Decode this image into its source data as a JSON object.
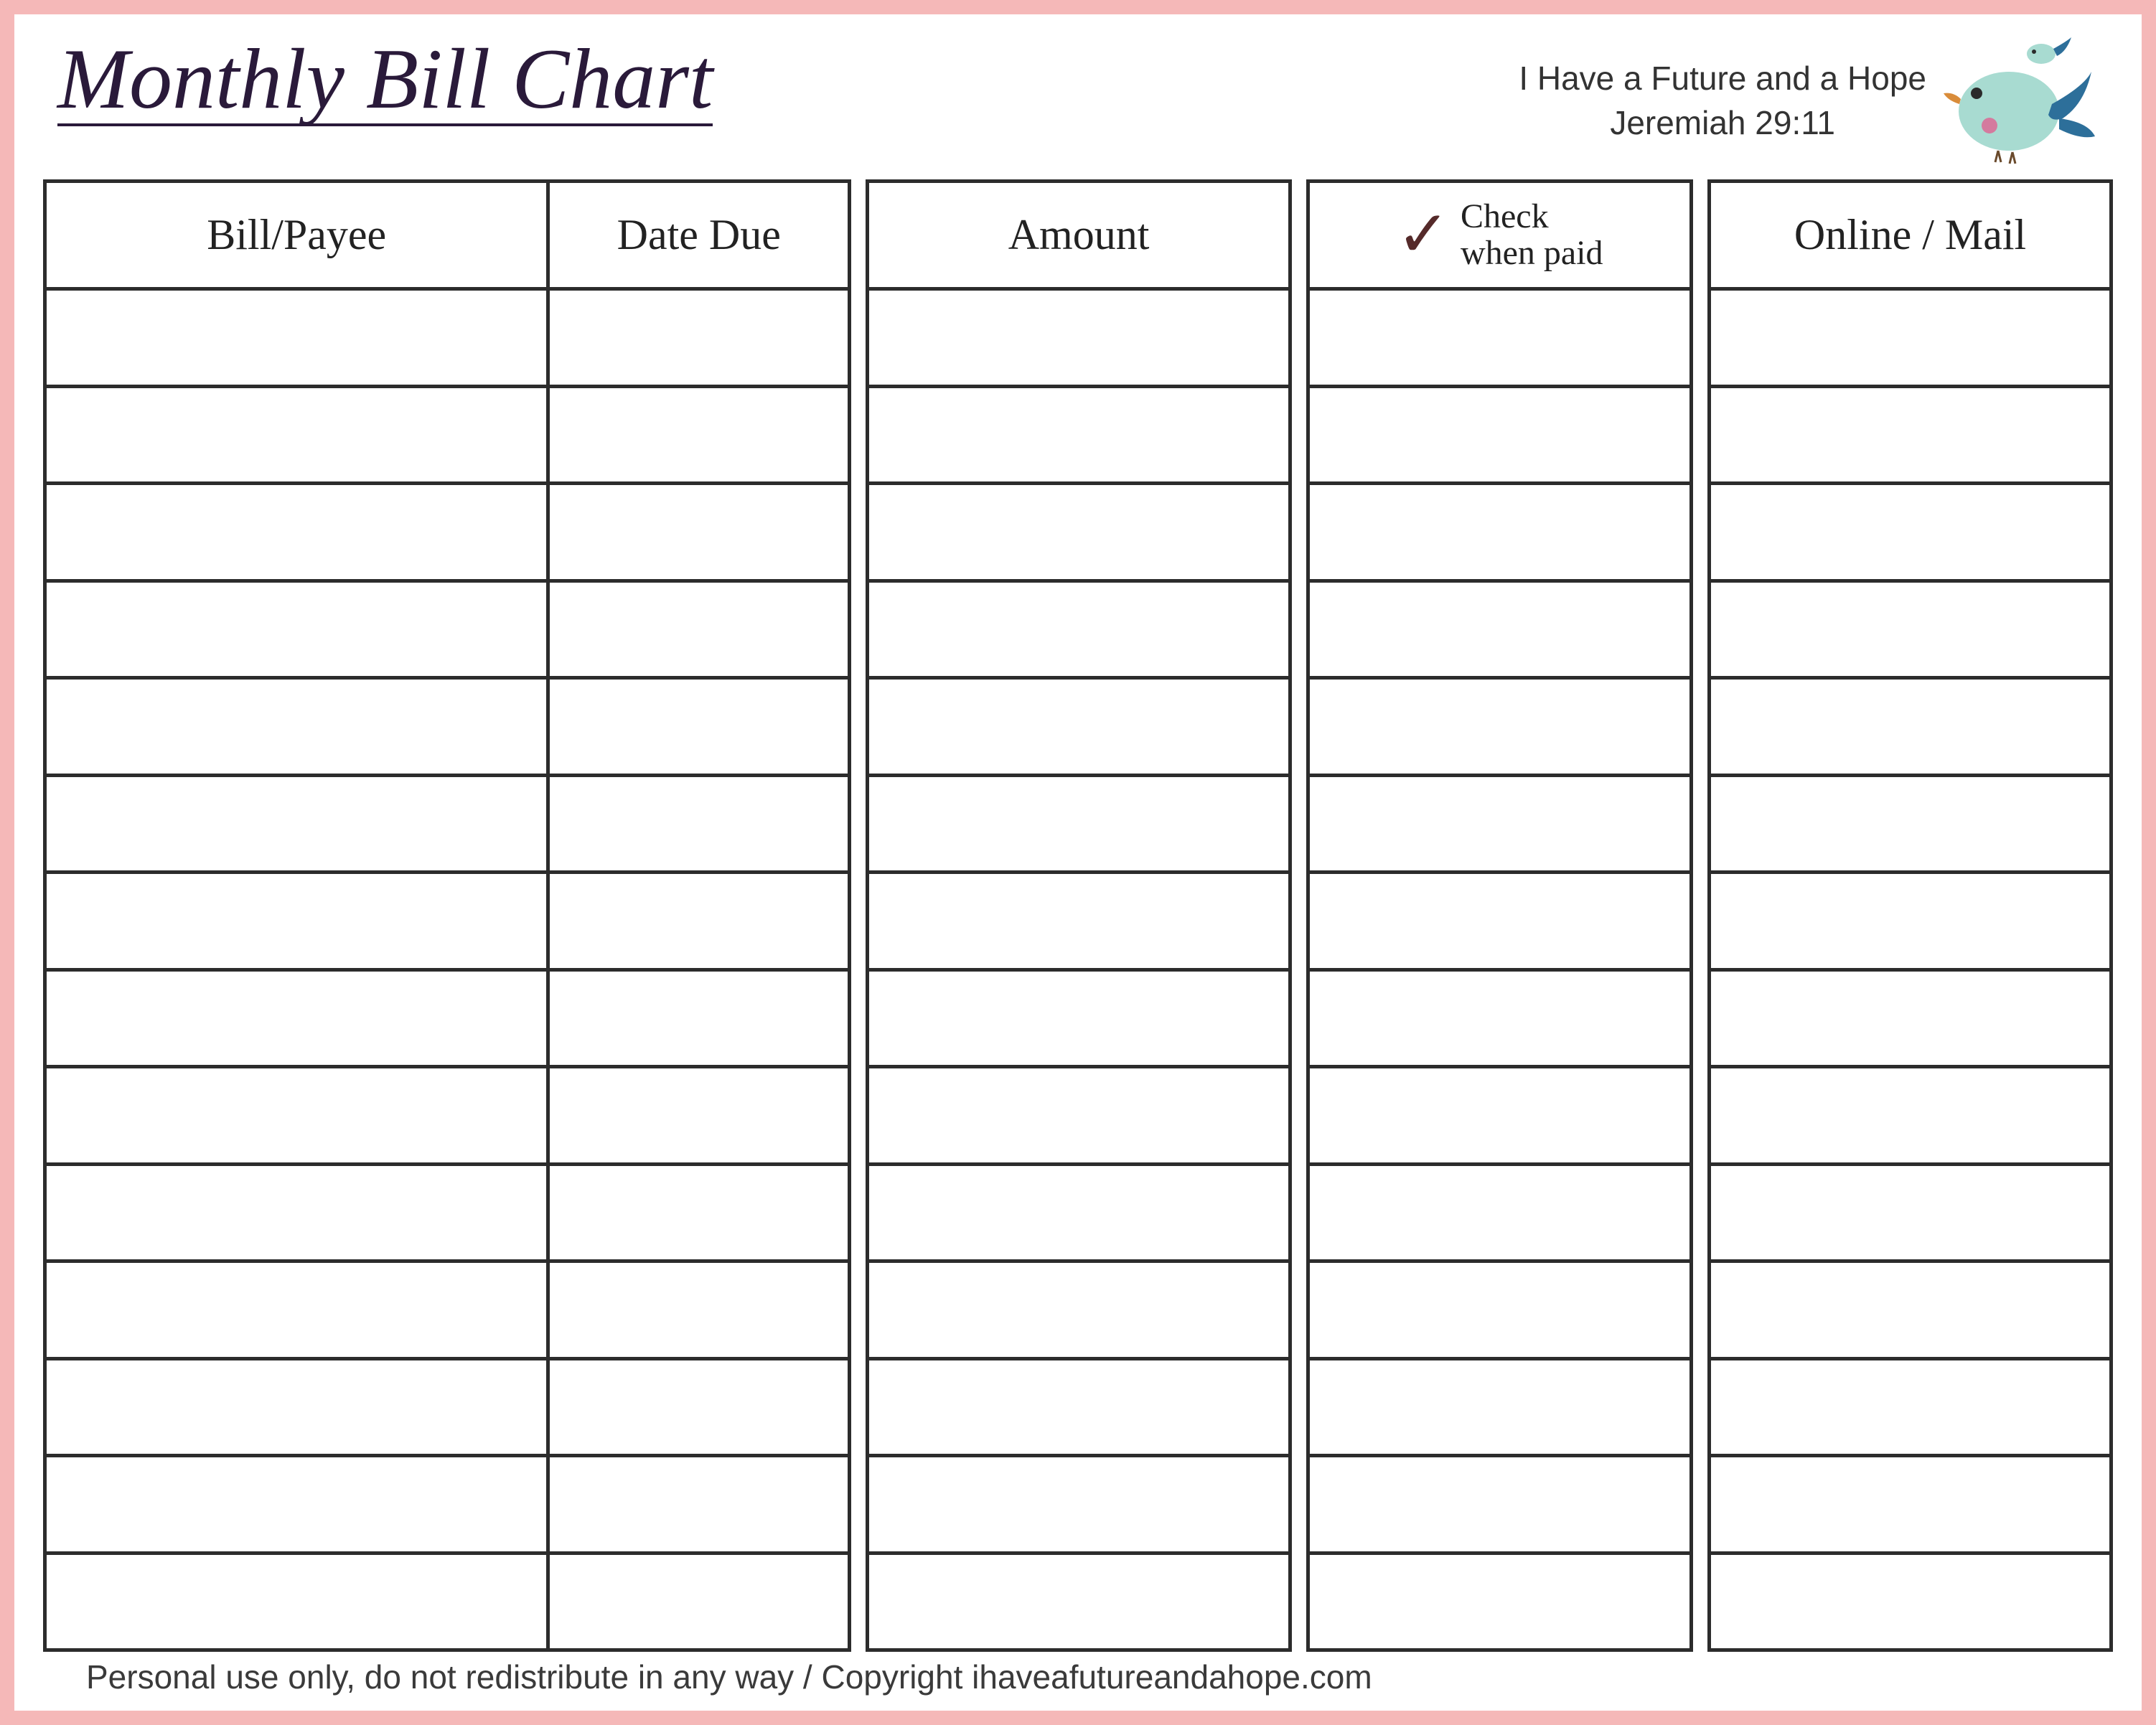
{
  "title": "Monthly Bill Chart",
  "verse": {
    "line1": "I Have a Future and a Hope",
    "line2": "Jeremiah 29:11"
  },
  "columns": {
    "bill_payee": "Bill/Payee",
    "date_due": "Date Due",
    "amount": "Amount",
    "check_line1": "Check",
    "check_line2": "when paid",
    "online_mail": "Online / Mail"
  },
  "row_count": 14,
  "footer": "Personal use only, do not redistribute in any way / Copyright ihaveafutureandahope.com"
}
